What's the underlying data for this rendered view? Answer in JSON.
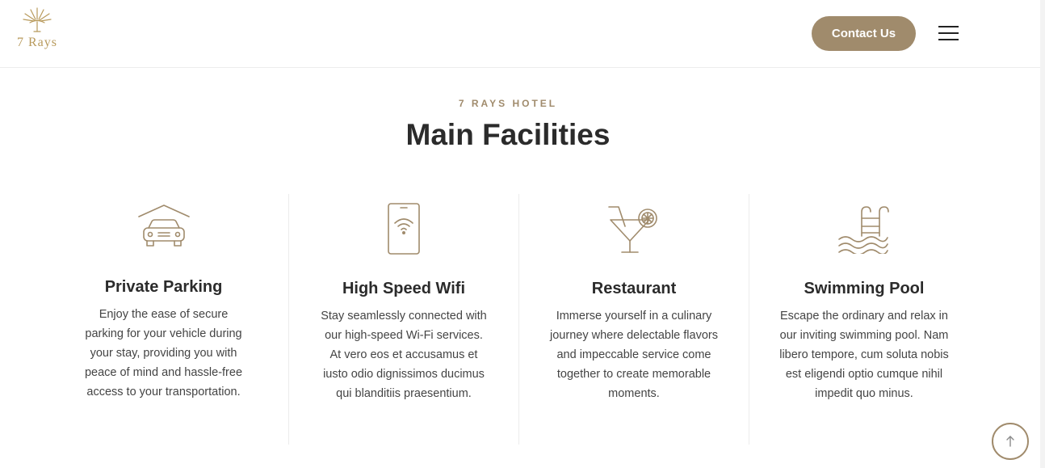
{
  "header": {
    "logo_text": "7 Rays",
    "contact_label": "Contact Us"
  },
  "section": {
    "eyebrow": "7 RAYS HOTEL",
    "title": "Main Facilities"
  },
  "facilities": [
    {
      "icon": "car-garage-icon",
      "title": "Private Parking",
      "description": "Enjoy the ease of secure parking for your vehicle during your stay, providing you with peace of mind and hassle-free access to your transportation."
    },
    {
      "icon": "smartphone-wifi-icon",
      "title": "High Speed Wifi",
      "description": "Stay seamlessly connected with our high-speed Wi-Fi services. At vero eos et accusamus et iusto odio dignissimos ducimus qui blanditiis praesentium."
    },
    {
      "icon": "cocktail-glass-icon",
      "title": "Restaurant",
      "description": "Immerse yourself in a culinary journey where delectable flavors and impeccable service come together to create memorable moments."
    },
    {
      "icon": "swimming-pool-icon",
      "title": "Swimming Pool",
      "description": "Escape the ordinary and relax in our inviting swimming pool. Nam libero tempore, cum soluta nobis est eligendi optio cumque nihil impedit quo minus."
    }
  ],
  "colors": {
    "accent": "#a08b6c",
    "logo_gold": "#b89a5c",
    "text_dark": "#2b2b2b"
  }
}
